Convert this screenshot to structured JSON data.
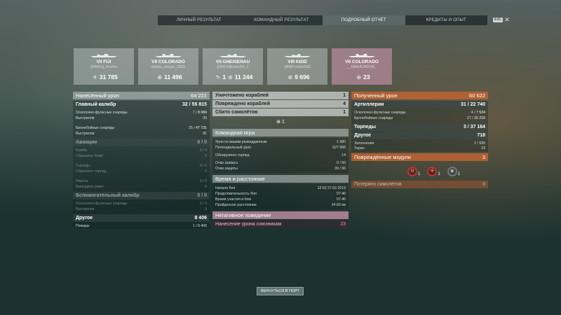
{
  "nav": {
    "tabs": [
      "ЛИЧНЫЙ РЕЗУЛЬТАТ",
      "КОМАНДНЫЙ РЕЗУЛЬТАТ",
      "ПОДРОБНЫЙ ОТЧЁТ",
      "КРЕДИТЫ И ОПЫТ"
    ],
    "active_index": 2,
    "esc_label": "ESC"
  },
  "ships": [
    {
      "name": "VII FIJI",
      "player": "[DRAG]_Arshin",
      "stat_icon": "plane-icon",
      "stat": "31 785"
    },
    {
      "name": "VII COLORADO",
      "player": "dubas_sergio_2015",
      "stat_icon": "crosshair-icon",
      "stat": "11 496"
    },
    {
      "name": "VII GNEISENAU",
      "player": "[OMCH]kola199_1",
      "stat_icon": "kills-icon",
      "stat_prefix": "1",
      "stat": "11 244"
    },
    {
      "name": "VIII KIDD",
      "player": "[4M]Froske003",
      "stat_icon": "crosshair-icon",
      "stat": "9 696"
    },
    {
      "name": "VII COLORADO",
      "player": "__NAKAZATOR_",
      "stat_icon": "crosshair-icon",
      "stat": "23",
      "self": true
    }
  ],
  "damage_dealt": {
    "header": {
      "label": "Нанесённый урон",
      "value": "64 221"
    },
    "main_battery": {
      "label": "Главный калибр",
      "value": "32 / 55 815"
    },
    "he": {
      "label": "Осколочно-фугасные снаряды",
      "value_a": "7",
      "value_b": "8 084"
    },
    "he_shots": {
      "label": "Выстрелов",
      "value": "30"
    },
    "ap": {
      "label": "Бронебойные снаряды",
      "value_a": "25",
      "value_b": "47 731"
    },
    "ap_shots": {
      "label": "Выстрелов",
      "value": "81"
    },
    "aviation": {
      "label": "Авиация",
      "value": "0 / 0"
    },
    "bombs": {
      "label": "Бомбы",
      "value": "0 / 0"
    },
    "bombs_dropped": {
      "label": "Сброшено бомб",
      "value": "0"
    },
    "torpedoes": {
      "label": "Торпеды",
      "value": "0 / 0"
    },
    "torpedoes_dropped": {
      "label": "Сброшено торпед",
      "value": "0"
    },
    "rockets": {
      "label": "Ракеты",
      "value": "0 / 0"
    },
    "rockets_fired": {
      "label": "Выпущено ракет",
      "value": "0"
    },
    "secondary": {
      "label": "Вспомогательный калибр",
      "value": "0 / 0"
    },
    "sec_he": {
      "label": "Осколочно-фугасные снаряды",
      "value": "0 / 0"
    },
    "sec_shots": {
      "label": "Выстрелов",
      "value": "0"
    },
    "other": {
      "label": "Другое",
      "value": "8 406"
    },
    "fires": {
      "label": "Пожары",
      "value": "1 / 8 406"
    }
  },
  "middle": {
    "destroyed": {
      "label": "Уничтожено кораблей",
      "value": "1"
    },
    "damaged": {
      "label": "Повреждено кораблей",
      "value": "4"
    },
    "planes": {
      "label": "Сбито самолётов",
      "value": "1"
    },
    "planes_center": "1",
    "team_header": "Командная игра",
    "spotting": {
      "label": "Урон по вашим разведданным",
      "value": "1 980"
    },
    "potential": {
      "label": "Потенциальный урон",
      "value": "627 566"
    },
    "torps_spotted": {
      "label": "Обнаружено торпед",
      "value": "14"
    },
    "capture": {
      "label": "Очки захвата",
      "value": "0 / 60"
    },
    "defense": {
      "label": "Очки защиты",
      "value": "39 / 96"
    },
    "time_header": "Время и расстояние",
    "battle_start": {
      "label": "Начало боя",
      "value": "12:52 27.02.2019"
    },
    "duration": {
      "label": "Продолжительность боя",
      "value": "07:46"
    },
    "participation": {
      "label": "Время участия в бою",
      "value": "07:46"
    },
    "distance": {
      "label": "Пройденное расстояние",
      "value": "24.60 км"
    },
    "negative_header": "Негативное поведение",
    "team_damage": {
      "label": "Нанесение урона союзникам",
      "value": "23"
    }
  },
  "received": {
    "header": {
      "label": "Полученный урон",
      "value": "60 622"
    },
    "artillery": {
      "label": "Артиллерия",
      "value": "31 / 22 740"
    },
    "he": {
      "label": "Осколочно-фугасные снаряды",
      "value_a": "4",
      "value_b": "7 524"
    },
    "ap": {
      "label": "Бронебойные снаряды",
      "value_a": "27",
      "value_b": "15 216"
    },
    "torpedoes": {
      "label": "Торпеды",
      "value": "3 / 37 164"
    },
    "other": {
      "label": "Другое",
      "value": "718"
    },
    "flooding": {
      "label": "Затопления",
      "value": "2 / 695"
    },
    "ram": {
      "label": "Таран",
      "value": "23"
    },
    "modules": {
      "label": "Повреждённые модули",
      "value": "3"
    },
    "module_icons": [
      {
        "icon": "engine-icon",
        "count": "1"
      },
      {
        "icon": "steering-icon",
        "count": "1"
      },
      {
        "icon": "turret-icon",
        "count": "1"
      }
    ],
    "planes_lost": {
      "label": "Потеряно самолётов",
      "value": "0"
    }
  },
  "footer": {
    "back_label": "ВЕРНУТЬСЯ В ПОРТ"
  }
}
